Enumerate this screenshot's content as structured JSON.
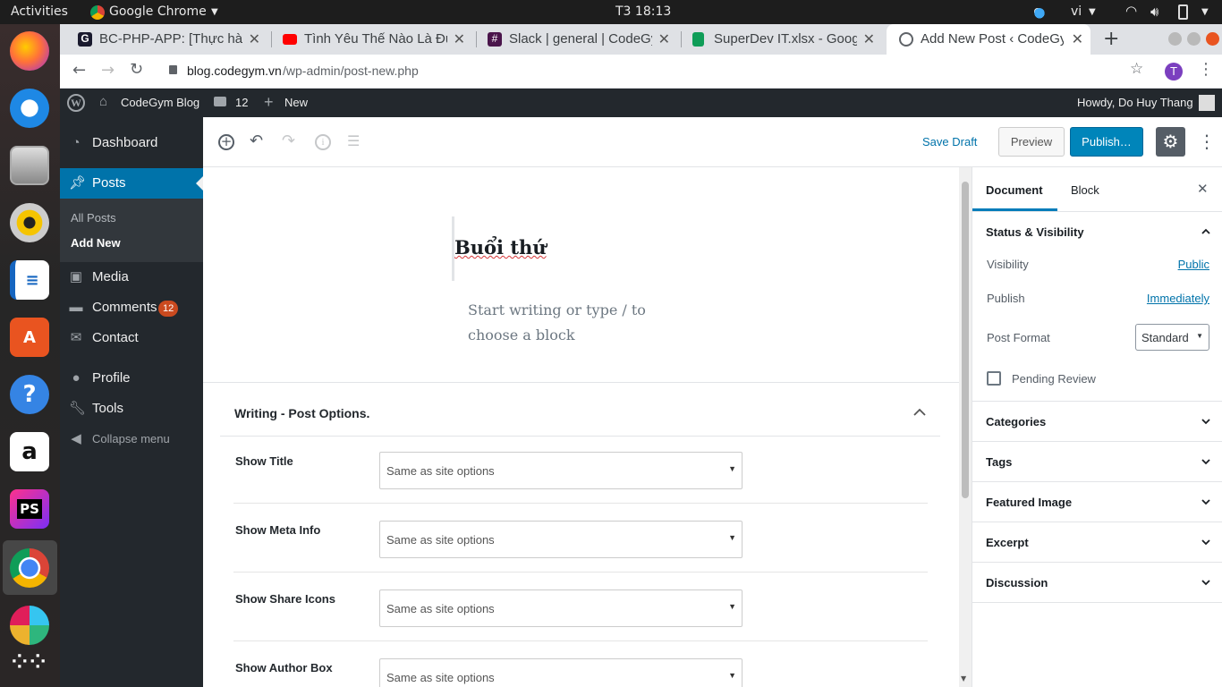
{
  "topbar": {
    "activities": "Activities",
    "app": "Google Chrome",
    "clock": "T3 18:13",
    "lang": "vi"
  },
  "tabs": [
    {
      "label": "BC-PHP-APP: [Thực hàn",
      "color": "#1a1a2e"
    },
    {
      "label": "Tình Yêu Thế Nào Là Đủ",
      "color": "#ff0000"
    },
    {
      "label": "Slack | general | CodeGy",
      "color": "#4a154b"
    },
    {
      "label": "SuperDev IT.xlsx - Googl",
      "color": "#0f9d58"
    },
    {
      "label": "Add New Post ‹ CodeGym",
      "color": "#5f6368"
    }
  ],
  "address": {
    "host": "blog.codegym.vn",
    "path": "/wp-admin/post-new.php",
    "avatar": "T"
  },
  "adminbar": {
    "site": "CodeGym Blog",
    "comments": "12",
    "new": "New",
    "howdy": "Howdy, Do Huy Thang"
  },
  "sidebar": {
    "dashboard": "Dashboard",
    "posts": "Posts",
    "all_posts": "All Posts",
    "add_new": "Add New",
    "media": "Media",
    "comments": "Comments",
    "comments_badge": "12",
    "contact": "Contact",
    "profile": "Profile",
    "tools": "Tools",
    "collapse": "Collapse menu"
  },
  "toolbar": {
    "save_draft": "Save Draft",
    "preview": "Preview",
    "publish": "Publish…"
  },
  "editor": {
    "title": "Buổi thứ",
    "placeholder_line1": "Start writing or type / to",
    "placeholder_line2": "choose a block",
    "options_title": "Writing - Post Options.",
    "options": [
      {
        "label": "Show Title",
        "value": "Same as site options"
      },
      {
        "label": "Show Meta Info",
        "value": "Same as site options"
      },
      {
        "label": "Show Share Icons",
        "value": "Same as site options"
      },
      {
        "label": "Show Author Box",
        "value": "Same as site options"
      }
    ]
  },
  "settings": {
    "tab_document": "Document",
    "tab_block": "Block",
    "status_title": "Status & Visibility",
    "visibility_label": "Visibility",
    "visibility_value": "Public",
    "publish_label": "Publish",
    "publish_value": "Immediately",
    "format_label": "Post Format",
    "format_value": "Standard",
    "pending": "Pending Review",
    "categories": "Categories",
    "tags": "Tags",
    "featured": "Featured Image",
    "excerpt": "Excerpt",
    "discussion": "Discussion"
  },
  "colors": {
    "wp_blue": "#0085ba",
    "admin_dark": "#23282d",
    "link": "#0073aa"
  }
}
